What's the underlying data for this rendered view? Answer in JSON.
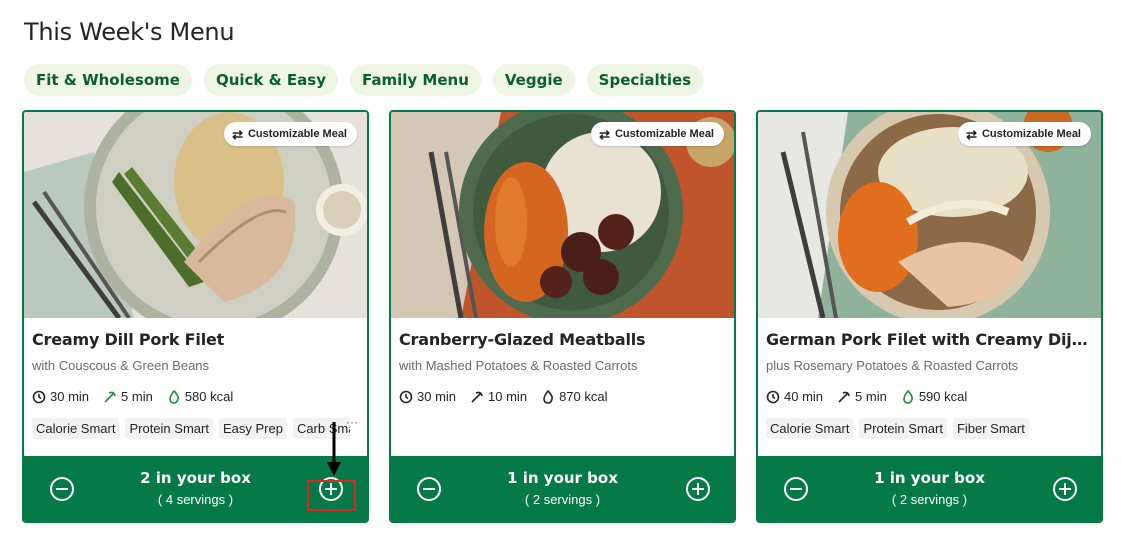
{
  "page_title": "This Week's Menu",
  "chips": [
    "Fit & Wholesome",
    "Quick & Easy",
    "Family Menu",
    "Veggie",
    "Specialties"
  ],
  "badge_label": "Customizable Meal",
  "cards": [
    {
      "title": "Creamy Dill Pork Filet",
      "subtitle": "with Couscous & Green Beans",
      "time": "30 min",
      "prep": "5 min",
      "kcal": "580 kcal",
      "tags": [
        "Calorie Smart",
        "Protein Smart",
        "Easy Prep",
        "Carb Smart"
      ],
      "more": "···",
      "count": "2 in your box",
      "servings": "( 4 servings )"
    },
    {
      "title": "Cranberry-Glazed Meatballs",
      "subtitle": "with Mashed Potatoes & Roasted Carrots",
      "time": "30 min",
      "prep": "10 min",
      "kcal": "870 kcal",
      "tags": [],
      "count": "1 in your box",
      "servings": "( 2 servings )"
    },
    {
      "title": "German Pork Filet with Creamy Dijon Sauce",
      "subtitle": "plus Rosemary Potatoes & Roasted Carrots",
      "time": "40 min",
      "prep": "5 min",
      "kcal": "590 kcal",
      "tags": [
        "Calorie Smart",
        "Protein Smart",
        "Fiber Smart"
      ],
      "count": "1 in your box",
      "servings": "( 2 servings )"
    }
  ],
  "colors": {
    "brand_green": "#067a46",
    "chip_bg": "#eef6e3",
    "chip_text": "#0b5e2f",
    "highlight_red": "#e0242a"
  },
  "icons": [
    "clock-icon",
    "prep-icon",
    "calorie-icon",
    "swap-icon",
    "minus-icon",
    "plus-icon",
    "arrow-down-icon"
  ]
}
